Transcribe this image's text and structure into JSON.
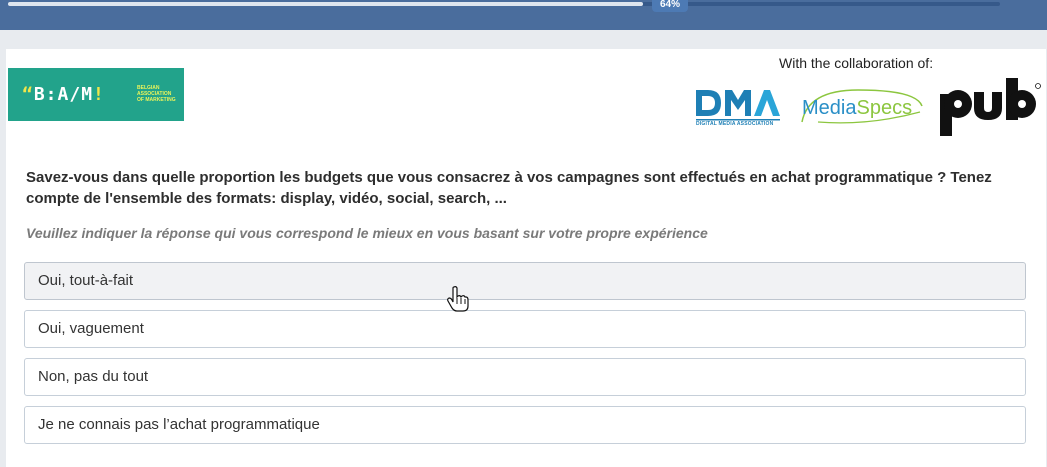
{
  "progress": {
    "percent_label": "64%",
    "fraction": 0.64
  },
  "brand": {
    "bam_quote": "“",
    "bam_letters": "B:A/M",
    "bam_exclaim": "!",
    "bam_subtitle_lines": [
      "BELGIAN",
      "ASSOCIATION",
      "OF MARKETING"
    ]
  },
  "collaboration": {
    "label": "With the collaboration of:",
    "dma_caption": "DIGITAL MEDIA ASSOCIATION",
    "dma_text": "DMA",
    "mediaspecs_text": "MediaSpecs",
    "pub_text": "pub"
  },
  "question": {
    "text": "Savez-vous dans quelle proportion les budgets que vous consacrez à vos campagnes sont effectués en achat programmatique ? Tenez compte de l'ensemble des formats: display, vidéo, social, search, ...",
    "instruction": "Veuillez indiquer la réponse qui vous correspond le mieux en vous basant sur votre propre expérience"
  },
  "options": [
    {
      "label": "Oui, tout-à-fait",
      "hovered": true
    },
    {
      "label": "Oui, vaguement",
      "hovered": false
    },
    {
      "label": "Non, pas du tout",
      "hovered": false
    },
    {
      "label": "Je ne connais pas l’achat programmatique",
      "hovered": false
    }
  ],
  "colors": {
    "topbar": "#4a6d9d",
    "bam_green": "#22a38b",
    "dma_blue": "#1e7fb5",
    "mediaspecs_green": "#8cc63f",
    "mediaspecs_blue": "#2a8fc7"
  },
  "cursor": "hand-pointer-icon"
}
